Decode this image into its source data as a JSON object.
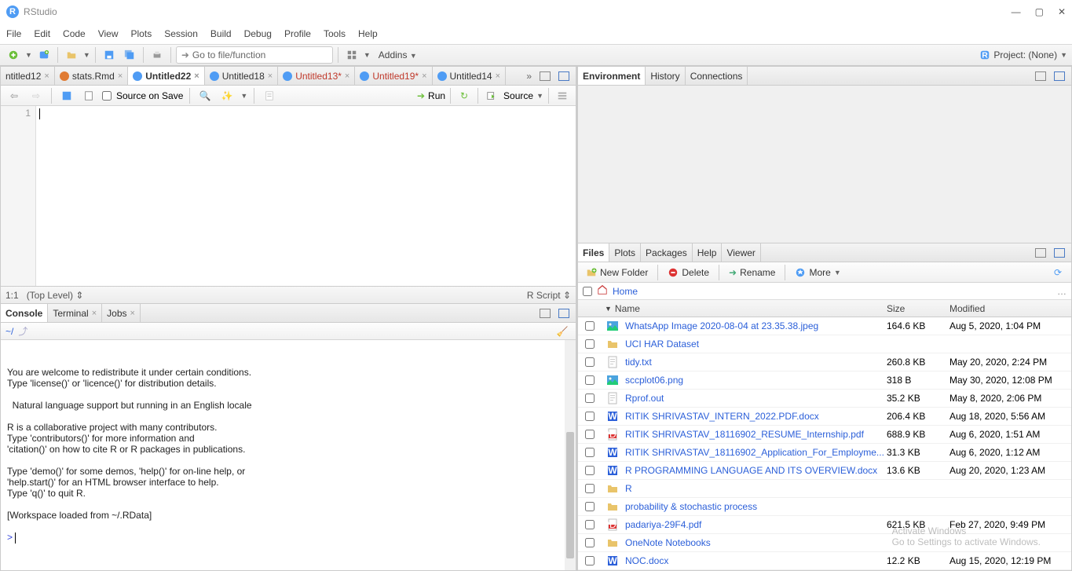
{
  "window": {
    "title": "RStudio"
  },
  "menus": [
    "File",
    "Edit",
    "Code",
    "View",
    "Plots",
    "Session",
    "Build",
    "Debug",
    "Profile",
    "Tools",
    "Help"
  ],
  "toolbar": {
    "goto_placeholder": "Go to file/function",
    "addins": "Addins",
    "project_label": "Project: (None)"
  },
  "source": {
    "tabs": [
      {
        "label": "ntitled12",
        "icon": "none",
        "modified": false
      },
      {
        "label": "stats.Rmd",
        "icon": "orange",
        "modified": false
      },
      {
        "label": "Untitled22",
        "icon": "blue",
        "modified": false,
        "active": true
      },
      {
        "label": "Untitled18",
        "icon": "blue",
        "modified": false
      },
      {
        "label": "Untitled13*",
        "icon": "blue",
        "modified": true
      },
      {
        "label": "Untitled19*",
        "icon": "blue",
        "modified": true
      },
      {
        "label": "Untitled14",
        "icon": "blue",
        "modified": false
      }
    ],
    "source_on_save": "Source on Save",
    "run_label": "Run",
    "source_label": "Source",
    "line_number": "1",
    "status_pos": "1:1",
    "status_scope": "(Top Level)",
    "status_lang": "R Script"
  },
  "console": {
    "tabs": {
      "console": "Console",
      "terminal": "Terminal",
      "jobs": "Jobs"
    },
    "prompt_path": "~/",
    "text_lines": [
      "You are welcome to redistribute it under certain conditions.",
      "Type 'license()' or 'licence()' for distribution details.",
      "",
      "  Natural language support but running in an English locale",
      "",
      "R is a collaborative project with many contributors.",
      "Type 'contributors()' for more information and",
      "'citation()' on how to cite R or R packages in publications.",
      "",
      "Type 'demo()' for some demos, 'help()' for on-line help, or",
      "'help.start()' for an HTML browser interface to help.",
      "Type 'q()' to quit R.",
      "",
      "[Workspace loaded from ~/.RData]",
      ""
    ],
    "prompt": ">"
  },
  "env": {
    "tabs": {
      "environment": "Environment",
      "history": "History",
      "connections": "Connections"
    }
  },
  "files_pane": {
    "tabs": {
      "files": "Files",
      "plots": "Plots",
      "packages": "Packages",
      "help": "Help",
      "viewer": "Viewer"
    },
    "toolbar": {
      "new_folder": "New Folder",
      "delete": "Delete",
      "rename": "Rename",
      "more": "More"
    },
    "breadcrumb": "Home",
    "columns": {
      "name": "Name",
      "size": "Size",
      "modified": "Modified"
    },
    "rows": [
      {
        "icon": "img",
        "name": "WhatsApp Image 2020-08-04 at 23.35.38.jpeg",
        "size": "164.6 KB",
        "modified": "Aug 5, 2020, 1:04 PM"
      },
      {
        "icon": "folder",
        "name": "UCI HAR Dataset",
        "size": "",
        "modified": ""
      },
      {
        "icon": "txt",
        "name": "tidy.txt",
        "size": "260.8 KB",
        "modified": "May 20, 2020, 2:24 PM"
      },
      {
        "icon": "img",
        "name": "sccplot06.png",
        "size": "318 B",
        "modified": "May 30, 2020, 12:08 PM"
      },
      {
        "icon": "txt",
        "name": "Rprof.out",
        "size": "35.2 KB",
        "modified": "May 8, 2020, 2:06 PM"
      },
      {
        "icon": "word",
        "name": "RITIK SHRIVASTAV_INTERN_2022.PDF.docx",
        "size": "206.4 KB",
        "modified": "Aug 18, 2020, 5:56 AM"
      },
      {
        "icon": "pdf",
        "name": "RITIK SHRIVASTAV_18116902_RESUME_Internship.pdf",
        "size": "688.9 KB",
        "modified": "Aug 6, 2020, 1:51 AM"
      },
      {
        "icon": "word",
        "name": "RITIK SHRIVASTAV_18116902_Application_For_Employme...",
        "size": "31.3 KB",
        "modified": "Aug 6, 2020, 1:12 AM"
      },
      {
        "icon": "word",
        "name": "R PROGRAMMING LANGUAGE AND ITS OVERVIEW.docx",
        "size": "13.6 KB",
        "modified": "Aug 20, 2020, 1:23 AM"
      },
      {
        "icon": "folder",
        "name": "R",
        "size": "",
        "modified": ""
      },
      {
        "icon": "folder",
        "name": "probability & stochastic process",
        "size": "",
        "modified": ""
      },
      {
        "icon": "pdf",
        "name": "padariya-29F4.pdf",
        "size": "621.5 KB",
        "modified": "Feb 27, 2020, 9:49 PM"
      },
      {
        "icon": "folder",
        "name": "OneNote Notebooks",
        "size": "",
        "modified": ""
      },
      {
        "icon": "word",
        "name": "NOC.docx",
        "size": "12.2 KB",
        "modified": "Aug 15, 2020, 12:19 PM"
      }
    ]
  },
  "watermark": {
    "line1": "Activate Windows",
    "line2": "Go to Settings to activate Windows."
  }
}
